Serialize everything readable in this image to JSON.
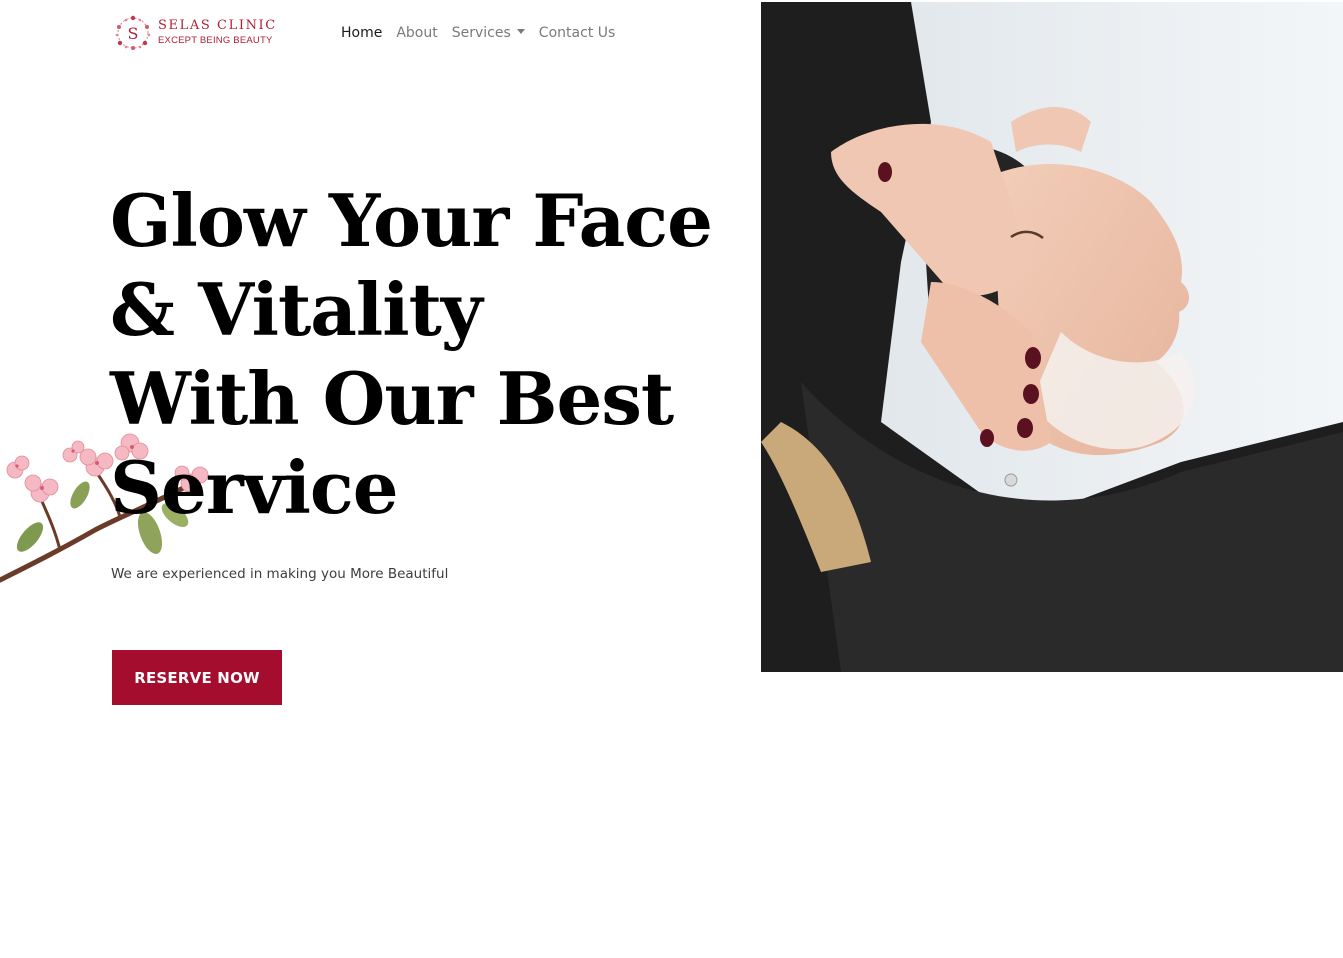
{
  "brand": {
    "name": "SELAS CLINIC",
    "tagline": "EXCEPT BEING BEAUTY",
    "monogram": "S",
    "color": "#b21f34"
  },
  "nav": {
    "items": [
      {
        "label": "Home",
        "active": true
      },
      {
        "label": "About",
        "active": false
      },
      {
        "label": "Services",
        "active": false,
        "dropdown": true
      },
      {
        "label": "Contact Us",
        "active": false
      }
    ]
  },
  "hero": {
    "title_lines": [
      "Glow Your Face",
      "& Vitality",
      "With Our Best",
      "Service"
    ],
    "subtitle": "We are experienced in making you More Beautiful",
    "cta_label": "RESERVE NOW",
    "cta_color": "#a50d2e"
  },
  "icons": {
    "dropdown": "caret-down-icon",
    "logo": "wreath-monogram-icon",
    "decoration": "cherry-blossom-branch"
  }
}
